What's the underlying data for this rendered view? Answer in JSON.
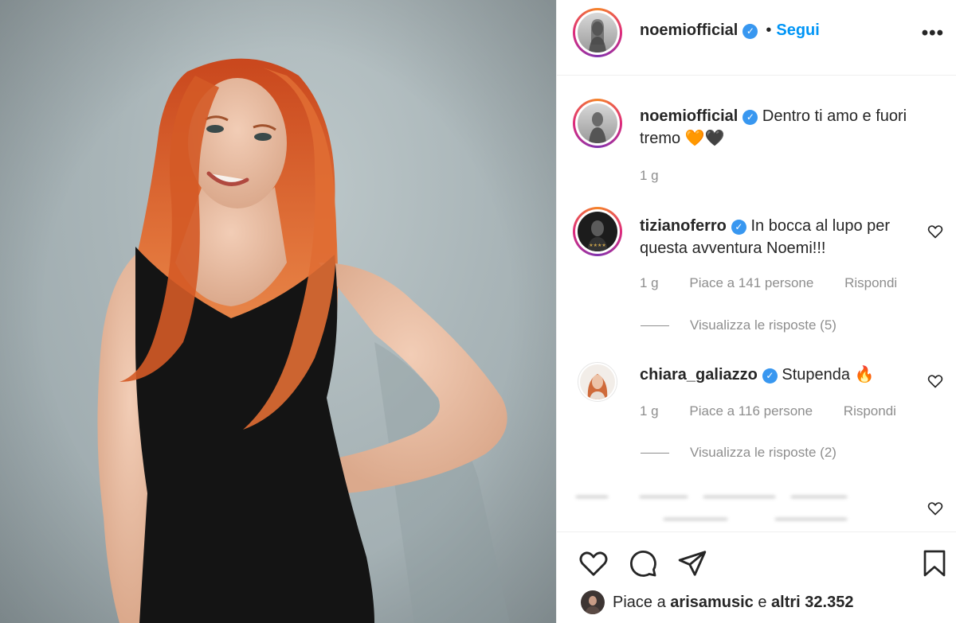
{
  "post": {
    "author": "noemiofficial",
    "follow_label": "Segui",
    "dot": "•",
    "more_label": "•••"
  },
  "caption": {
    "author": "noemiofficial",
    "text": "Dentro ti amo e fuori tremo",
    "emoji": "🧡🖤",
    "time": "1 g"
  },
  "comments": [
    {
      "author": "tizianoferro",
      "text": "In bocca al lupo per questa avventura Noemi!!!",
      "time": "1 g",
      "likes": "Piace a 141 persone",
      "reply": "Rispondi",
      "view_replies": "Visualizza le risposte (5)"
    },
    {
      "author": "chiara_galiazzo",
      "text": "Stupenda",
      "emoji": "🔥",
      "time": "1 g",
      "likes": "Piace a 116 persone",
      "reply": "Rispondi",
      "view_replies": "Visualizza le risposte (2)"
    }
  ],
  "likes_summary": {
    "prefix": "Piace a",
    "user": "arisamusic",
    "connector": "e",
    "rest": "altri 32.352"
  },
  "icons": {
    "like": "heart-icon",
    "comment": "comment-icon",
    "share": "share-icon",
    "save": "bookmark-icon",
    "verified": "verified-badge",
    "more": "more-options-icon"
  },
  "colors": {
    "accent": "#0095f6",
    "verified": "#3897f0",
    "text": "#262626",
    "muted": "#8e8e8e",
    "hair": "#d9622b"
  }
}
